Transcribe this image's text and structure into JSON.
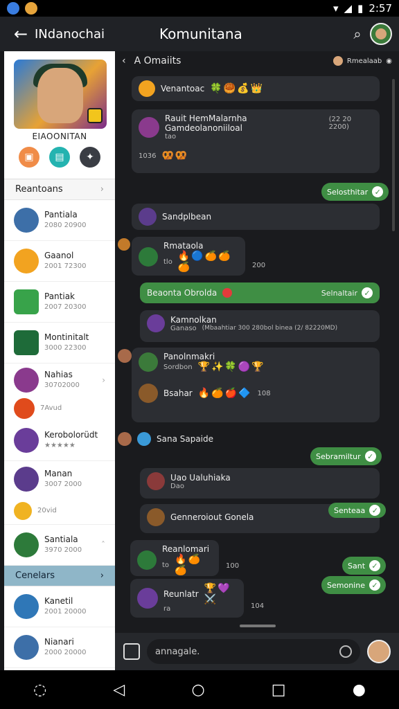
{
  "status": {
    "time": "2:57"
  },
  "appbar": {
    "back_icon": "arrow-back-icon",
    "left_title": "INdanochai",
    "center_title": "Komunitana",
    "search_icon": "search-icon"
  },
  "profile": {
    "name": "EIAOONITAN"
  },
  "sidebar": {
    "section1": "Reantoans",
    "items": [
      {
        "name": "Pantiala",
        "sub": "2080 20900"
      },
      {
        "name": "Gaanol",
        "sub": "2001 72300"
      },
      {
        "name": "Pantiak",
        "sub": "2007 20300"
      },
      {
        "name": "Montinitalt",
        "sub": "3000 22300"
      },
      {
        "name": "Nahias",
        "sub": "30702000"
      },
      {
        "name": "",
        "sub": "7Avud"
      },
      {
        "name": "Kerobolorüdt",
        "sub": "★★★★★"
      },
      {
        "name": "Manan",
        "sub": "3007 2000"
      },
      {
        "name": "",
        "sub": "20vid"
      },
      {
        "name": "Santiala",
        "sub": "3970 2000"
      }
    ],
    "section2": "Cenelars",
    "items2": [
      {
        "name": "Kanetil",
        "sub": "2001 20000"
      },
      {
        "name": "Nianari",
        "sub": "2000 20000"
      }
    ]
  },
  "chat": {
    "header": "A Omaiits",
    "header_right": "Rmealaab",
    "messages": [
      {
        "text": "Venantoac",
        "emoji": "🍀🥮💰👑"
      },
      {
        "title": "Rauit HemMalarnha Gamdeolanoniiloal",
        "date": "(22 20 2200)",
        "line2": "tao",
        "meta": "1036",
        "emoji": "🥨🥨"
      },
      {
        "pill": "Selosthitar"
      },
      {
        "text": "Sandplbean"
      },
      {
        "title": "Rmataola",
        "line2": "tlo",
        "emoji": "🔥🔵🍊🍊🍊",
        "meta": "200"
      },
      {
        "green": "Beaonta Obrolda",
        "pill_right": "Selnaltair"
      },
      {
        "title": "Kamnolkan",
        "line2": "Ganaso",
        "date": "(Mbaahtiar 300 280bol binea (2/ 82220MD)"
      },
      {
        "title": "Panolnmakri",
        "line2": "Sordbon",
        "emoji": "🏆✨🍀🟣🏆",
        "meta": ""
      },
      {
        "title": "Bsahar",
        "emoji": "🔥🍊🍎🔷",
        "meta": "108"
      },
      {
        "title": "Sana Sapaide"
      },
      {
        "pill": "Sebramiltur"
      },
      {
        "title": "Uao Ualuhiaka",
        "line2": "Dao"
      },
      {
        "title": "Genneroiout Gonela",
        "pill": "Senteaa"
      },
      {
        "title": "Reanlomari",
        "line2": "to",
        "emoji": "🔥🍊🍊",
        "meta": "100"
      },
      {
        "pill": "Sant"
      },
      {
        "pill": "Semonine"
      },
      {
        "title": "Reunlatr",
        "line2": "ra",
        "emoji": "🏆💜⚔️",
        "meta": "104"
      }
    ],
    "composer": {
      "placeholder": "annagale.",
      "camera_icon": "camera-icon"
    }
  },
  "colors": {
    "accent": "#3f8e44",
    "bg": "#1a1b1e"
  }
}
